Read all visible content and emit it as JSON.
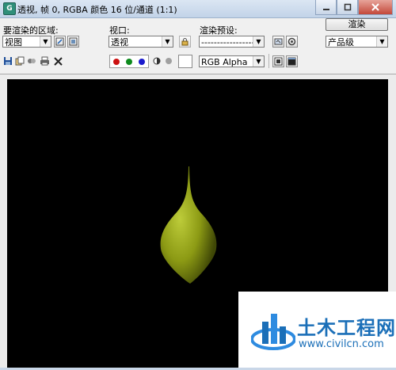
{
  "window": {
    "title": "透视, 帧 0, RGBA 颜色 16 位/通道 (1:1)",
    "icon_text": "G"
  },
  "area": {
    "label": "要渲染的区域:",
    "value": "视图"
  },
  "viewport": {
    "label": "视口:",
    "value": "透视"
  },
  "preset": {
    "label": "渲染预设:",
    "value": "--------------------"
  },
  "render": {
    "button_label": "渲染",
    "quality_value": "产品级"
  },
  "channel": {
    "value": "RGB Alpha"
  },
  "colors": {
    "red": "#cc1111",
    "green": "#0d8a1c",
    "blue": "#1a1acc",
    "canvas_bg": "#000000",
    "object": "#8c9a14"
  },
  "watermark": {
    "title": "土木工程网",
    "url": "www.civilcn.com"
  }
}
